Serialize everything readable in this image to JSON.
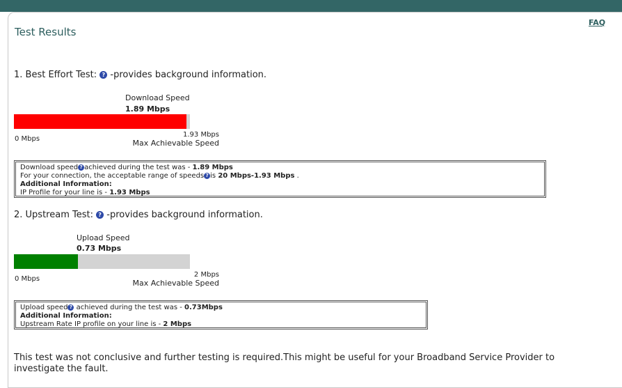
{
  "page": {
    "title": "Test Results",
    "faq_label": "FAQ"
  },
  "best_effort": {
    "heading_prefix": "1. Best Effort Test:",
    "heading_suffix": "-provides background information.",
    "bar_label": "Download Speed",
    "bar_value": "1.89 Mbps",
    "min_label": "0 Mbps",
    "max_label": "1.93 Mbps",
    "max_caption": "Max Achievable Speed",
    "measured_mbps": 1.89,
    "max_mbps": 1.93,
    "fill_color": "#ff0000",
    "info": {
      "line1_prefix": "Download speed",
      "line1_mid": "achieved during the test was - ",
      "line1_value": "1.89 Mbps",
      "line2_prefix": "For your connection, the acceptable range of speeds",
      "line2_mid": "is ",
      "line2_value": "20 Mbps-1.93 Mbps",
      "line2_suffix": " .",
      "additional_label": "Additional Information:",
      "line4_prefix": "IP Profile for your line is - ",
      "line4_value": "1.93 Mbps"
    }
  },
  "upstream": {
    "heading_prefix": "2. Upstream Test:",
    "heading_suffix": "-provides background information.",
    "bar_label": "Upload Speed",
    "bar_value": "0.73 Mbps",
    "min_label": "0 Mbps",
    "max_label": "2 Mbps",
    "max_caption": "Max Achievable Speed",
    "measured_mbps": 0.73,
    "max_mbps": 2,
    "fill_color": "#008000",
    "info": {
      "line1_prefix": "Upload speed",
      "line1_mid": " achieved during the test was - ",
      "line1_value": "0.73Mbps",
      "additional_label": "Additional Information:",
      "line3_prefix": "Upstream Rate IP profile on your line is - ",
      "line3_value": "2 Mbps"
    }
  },
  "footer": {
    "message": "This test was not conclusive and further testing is required.This might be useful for your Broadband Service Provider to investigate the fault."
  },
  "icons": {
    "help": "help-icon",
    "help_glyph": "?"
  },
  "colors": {
    "header_bar": "#336666",
    "title_text": "#2e5f5f",
    "track": "#d3d3d3"
  }
}
